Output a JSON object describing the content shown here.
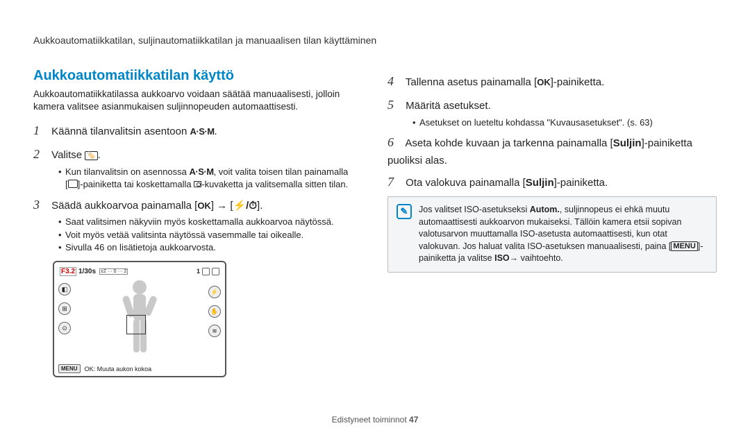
{
  "header": "Aukkoautomatiikkatilan, suljinautomatiikkatilan ja manuaalisen tilan käyttäminen",
  "section_title": "Aukkoautomatiikkatilan käyttö",
  "intro": "Aukkoautomatiikkatilassa aukkoarvo voidaan säätää manuaalisesti, jolloin kamera valitsee asianmukaisen suljinnopeuden automaattisesti.",
  "steps": {
    "s1_pre": "Käännä tilanvalitsin asentoon ",
    "s1_icon": "A·S·M",
    "s1_post": ".",
    "s2_pre": "Valitse ",
    "s2_post": ".",
    "s2_b1_a": "Kun tilanvalitsin on asennossa ",
    "s2_b1_b": ", voit valita toisen tilan painamalla",
    "s2_b2_a": "[",
    "s2_b2_b": "]-painiketta tai koskettamalla ",
    "s2_b2_c": "-kuvaketta ja valitsemalla sitten tilan.",
    "s3_pre": "Säädä aukkoarvoa painamalla [",
    "s3_mid": "] → [",
    "s3_post": "].",
    "s3_b1": "Saat valitsimen näkyviin myös koskettamalla aukkoarvoa näytössä.",
    "s3_b2": "Voit myös vetää valitsinta näytössä vasemmalle tai oikealle.",
    "s3_b3": "Sivulla 46 on lisätietoja aukkoarvosta.",
    "s4_pre": "Tallenna asetus painamalla [",
    "s4_post": "]-painiketta.",
    "s5": "Määritä asetukset.",
    "s5_b1": "Asetukset on lueteltu kohdassa \"Kuvausasetukset\". (s. 63)",
    "s6_a": "Aseta kohde kuvaan ja tarkenna painamalla [",
    "s6_b": "Suljin",
    "s6_c": "]-painiketta puoliksi alas.",
    "s7_a": "Ota valokuva painamalla [",
    "s7_b": "Suljin",
    "s7_c": "]-painiketta."
  },
  "note": {
    "a": "Jos valitset ISO-asetukseksi ",
    "autom": "Autom.",
    "b": ", suljinnopeus ei ehkä muutu automaattisesti aukkoarvon mukaiseksi. Tällöin kamera etsii sopivan valotusarvon muuttamalla ISO-asetusta automaattisesti, kun otat valokuvan. Jos haluat valita ISO-asetuksen manuaalisesti, paina [",
    "c": "]-painiketta ja valitse ",
    "iso": "ISO",
    "d": " → vaihtoehto."
  },
  "lcd": {
    "f": "F3.2",
    "shutter": "1/30s",
    "ev": "±2 ··· 0 ··· 2",
    "menu": "MENU",
    "ok_text": "OK: Muuta aukon kokoa"
  },
  "footer_a": "Edistyneet toiminnot  ",
  "footer_b": "47"
}
